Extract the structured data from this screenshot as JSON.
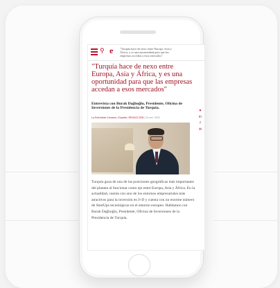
{
  "colors": {
    "accent": "#b8102a",
    "headline": "#9b0e1f"
  },
  "topbar": {
    "menu_icon": "hamburger-icon",
    "search_icon": "search-icon",
    "logo": "e",
    "quote_line1": "\"Turquía hace de nexo entre Europa, Asia y",
    "quote_line2": "África, y es una oportunidad para que las",
    "quote_line3": "empresas accedan a esos mercados\""
  },
  "article": {
    "headline": "\"Turquía hace de nexo entre Europa, Asia y África, y es una oportunidad para que las empresas accedan a esos mercados\"",
    "subhead": "Entrevista con Burak Dağlıoğlu, Presidente, Oficina de Inversiones de la Presidencia de Turquía.",
    "meta_section": "La Entrevista Cercana",
    "meta_country": "España",
    "meta_author": "REDACCIÓN",
    "meta_date": "24 nov. 2022",
    "body": "Turquía goza de una de las posiciones geográficas más importantes del planeta al funcionar como eje entre Europa, Asia y África. En la actualidad, cuenta con uno de los entornos empresariales más atractivos para la inversión en I+D y cuenta con un enorme número de StartUps tecnológicas en el entorno europeo. Hablamos con Burak Dağlıoğlu, Presidente, Oficina de Inversiones de la Presidencia de Turquía."
  },
  "share": [
    {
      "icon": "twitter-icon",
      "glyph": "♥"
    },
    {
      "icon": "linkedin-icon",
      "glyph": "in"
    },
    {
      "icon": "facebook-icon",
      "glyph": "f"
    },
    {
      "icon": "email-icon",
      "glyph": "✉"
    }
  ],
  "separator": " | "
}
